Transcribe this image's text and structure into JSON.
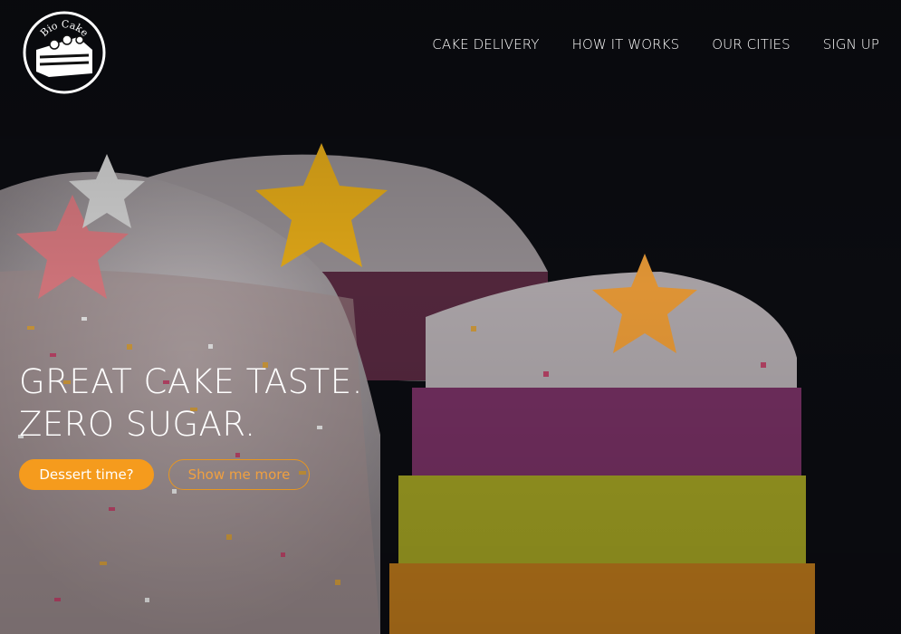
{
  "brand": {
    "logo_text": "Bio Cake",
    "icon": "cake-slice-icon"
  },
  "nav": {
    "items": [
      {
        "label": "CAKE DELIVERY"
      },
      {
        "label": "HOW IT WORKS"
      },
      {
        "label": "OUR CITIES"
      },
      {
        "label": "SIGN UP"
      }
    ]
  },
  "hero": {
    "headline_line1": "GREAT CAKE TASTE.",
    "headline_line2": "ZERO SUGAR.",
    "primary_button": "Dessert time?",
    "secondary_button": "Show me more"
  },
  "colors": {
    "accent": "#f59b1d",
    "text": "#ffffff",
    "background": "#0c0d12"
  }
}
